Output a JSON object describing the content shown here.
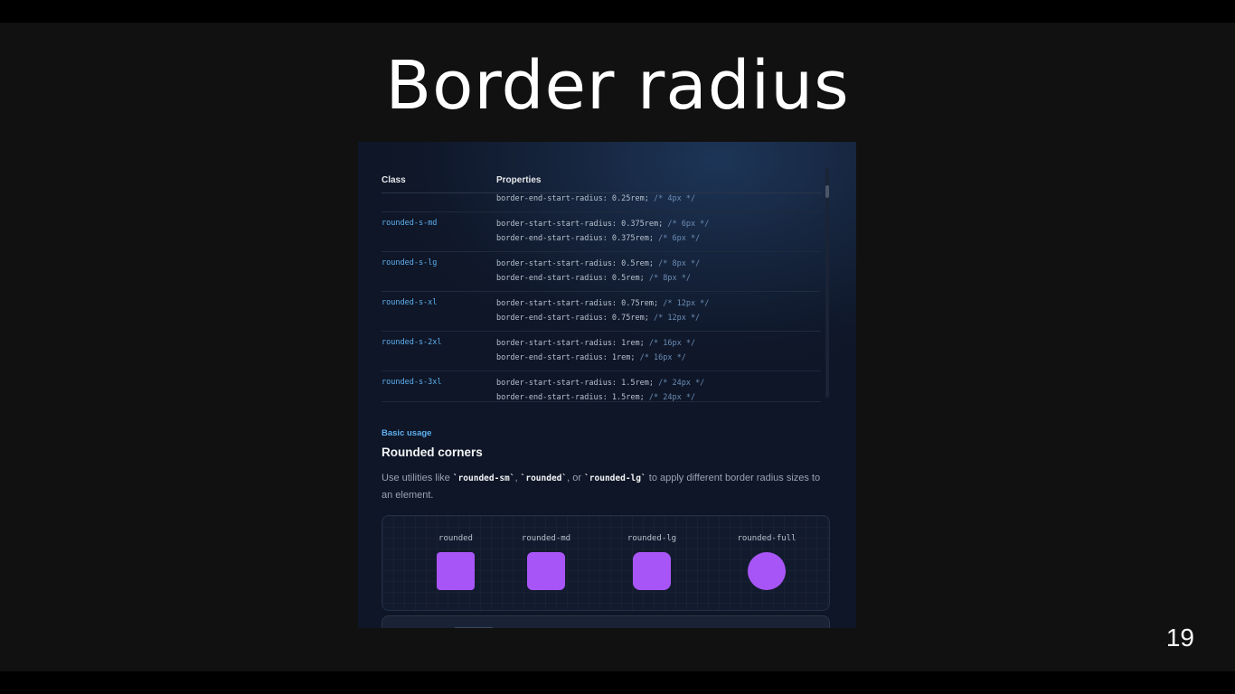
{
  "slide": {
    "title": "Border radius",
    "page_number": "19"
  },
  "table": {
    "headers": [
      "Class",
      "Properties"
    ],
    "rows": [
      {
        "class": "",
        "props": [
          [
            "border-end-start-radius: 0.25rem; ",
            "/* 4px */"
          ]
        ]
      },
      {
        "class": "rounded-s-md",
        "props": [
          [
            "border-start-start-radius: 0.375rem; ",
            "/* 6px */"
          ],
          [
            "border-end-start-radius: 0.375rem; ",
            "/* 6px */"
          ]
        ]
      },
      {
        "class": "rounded-s-lg",
        "props": [
          [
            "border-start-start-radius: 0.5rem; ",
            "/* 8px */"
          ],
          [
            "border-end-start-radius: 0.5rem; ",
            "/* 8px */"
          ]
        ]
      },
      {
        "class": "rounded-s-xl",
        "props": [
          [
            "border-start-start-radius: 0.75rem; ",
            "/* 12px */"
          ],
          [
            "border-end-start-radius: 0.75rem; ",
            "/* 12px */"
          ]
        ]
      },
      {
        "class": "rounded-s-2xl",
        "props": [
          [
            "border-start-start-radius: 1rem; ",
            "/* 16px */"
          ],
          [
            "border-end-start-radius: 1rem; ",
            "/* 16px */"
          ]
        ]
      },
      {
        "class": "rounded-s-3xl",
        "props": [
          [
            "border-start-start-radius: 1.5rem; ",
            "/* 24px */"
          ],
          [
            "border-end-start-radius: 1.5rem; ",
            "/* 24px */"
          ]
        ]
      }
    ]
  },
  "section": {
    "eyebrow": "Basic usage",
    "heading": "Rounded corners",
    "para_pre": "Use utilities like ",
    "code1": "`rounded-sm`",
    "sep1": ", ",
    "code2": "`rounded`",
    "sep2": ", or ",
    "code3": "`rounded-lg`",
    "para_post": " to apply different border radius sizes to an element."
  },
  "demo": {
    "items": [
      {
        "label": "rounded",
        "radius": "4px"
      },
      {
        "label": "rounded-md",
        "radius": "6px"
      },
      {
        "label": "rounded-lg",
        "radius": "8px"
      },
      {
        "label": "rounded-full",
        "radius": "50%"
      }
    ],
    "swatch_color": "#a855f7"
  },
  "colors": {
    "accent_blue": "#5fb0f0",
    "slide_bg": "#111111",
    "panel_bg": "#0f1729"
  }
}
